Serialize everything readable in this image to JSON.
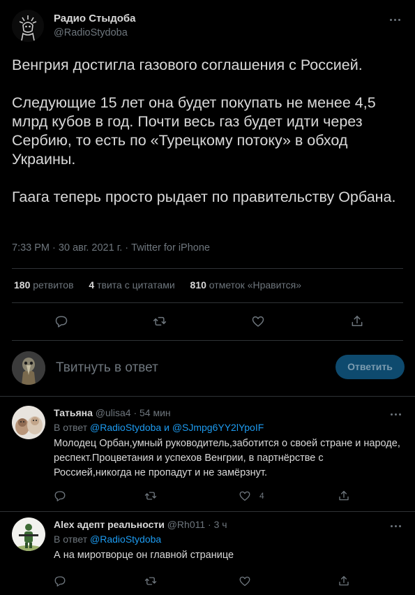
{
  "tweet": {
    "author_name": "Радио Стыдоба",
    "author_handle": "@RadioStydoba",
    "paragraphs": [
      "Венгрия достигла газового соглашения с Россией.",
      "Следующие 15 лет она будет покупать не менее 4,5 млрд кубов в год. Почти весь газ будет идти через Сербию, то есть по «Турецкому потоку» в обход Украины.",
      "Гаага теперь просто рыдает по правительству Орбана."
    ],
    "time": "7:33 PM",
    "date": "30 авг. 2021 г.",
    "source": "Twitter for iPhone",
    "separator": "·"
  },
  "stats": {
    "retweets_count": "180",
    "retweets_label": "ретвитов",
    "quotes_count": "4",
    "quotes_label": "твита с цитатами",
    "likes_count": "810",
    "likes_label": "отметок «Нравится»"
  },
  "reply_box": {
    "placeholder": "Твитнуть в ответ",
    "button_label": "Ответить"
  },
  "replies": [
    {
      "name": "Татьяна",
      "handle": "@ulisa4",
      "separator": "·",
      "time": "54 мин",
      "replying_prefix": "В ответ",
      "mention_1": "@RadioStydoba",
      "conj": "и",
      "mention_2": "@SJmpg6YY2lYpoIF",
      "text": "Молодец Орбан,умный руководитель,заботится о своей стране и народе, респект.Процветания и успехов Венгрии, в партнёрстве с Россией,никогда не пропадут и не замёрзнут.",
      "like_count": "4"
    },
    {
      "name": "Alex адепт реальности",
      "handle": "@Rh011",
      "separator": "·",
      "time": "3 ч",
      "replying_prefix": "В ответ",
      "mention_1": "@RadioStydoba",
      "text": "А на миротворце он главной странице",
      "like_count": ""
    }
  ],
  "icons": {
    "reply": "speech-bubble-icon",
    "retweet": "retweet-arrows-icon",
    "like": "heart-icon",
    "share": "share-upload-icon",
    "more": "ellipsis-icon"
  },
  "colors": {
    "background": "#000000",
    "text": "#d9d9d9",
    "muted": "#6e767d",
    "accent": "#1d9bf0",
    "button_bg": "#0e4a6e"
  }
}
